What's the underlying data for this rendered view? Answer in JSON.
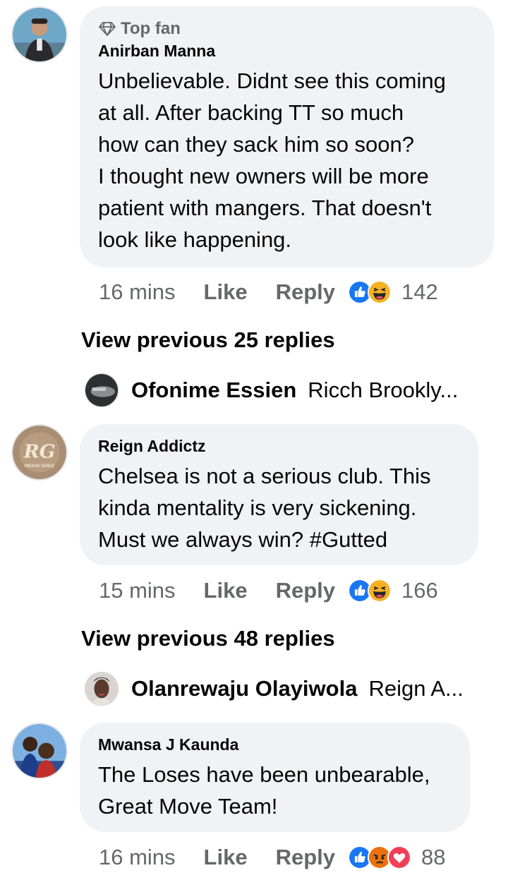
{
  "comments": [
    {
      "badge": "Top fan",
      "author": "Anirban Manna",
      "text_lines": [
        "Unbelievable. Didnt see this coming",
        "at all. After backing TT so much",
        "how can they sack him so soon?",
        "I thought new owners will be more",
        "patient with mangers. That doesn't",
        "look like happening."
      ],
      "time": "16 mins",
      "like_label": "Like",
      "reply_label": "Reply",
      "reactions": [
        "like",
        "haha"
      ],
      "reaction_count": "142",
      "view_previous": "View previous 25 replies",
      "latest_reply": {
        "name": "Ofonime Essien",
        "snippet": "Ricch Brookly..."
      }
    },
    {
      "author": "Reign Addictz",
      "avatar_text": "REIGN GODZ",
      "text_lines": [
        "Chelsea is not a serious club. This",
        "kinda mentality is very sickening.",
        "Must we always win? #Gutted"
      ],
      "time": "15 mins",
      "like_label": "Like",
      "reply_label": "Reply",
      "reactions": [
        "like",
        "haha"
      ],
      "reaction_count": "166",
      "view_previous": "View previous 48 replies",
      "latest_reply": {
        "name": "Olanrewaju Olayiwola",
        "snippet": "Reign A..."
      }
    },
    {
      "author": "Mwansa J Kaunda",
      "text_lines": [
        "The Loses have been unbearable,",
        "Great Move Team!"
      ],
      "time": "16 mins",
      "like_label": "Like",
      "reply_label": "Reply",
      "reactions": [
        "like",
        "angry",
        "love"
      ],
      "reaction_count": "88"
    }
  ],
  "colors": {
    "bubble_bg": "#f0f2f5",
    "meta_text": "#65676b",
    "like_blue": "#1877f2",
    "haha_yellow": "#f7b125",
    "angry_orange": "#e9710f",
    "love_red": "#f33e58"
  }
}
